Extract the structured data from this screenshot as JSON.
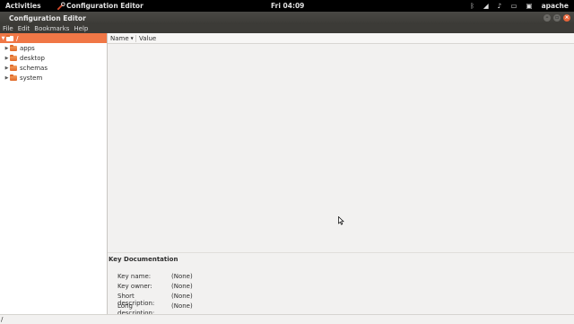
{
  "top_bar": {
    "activities": "Activities",
    "app_name": "Configuration Editor",
    "clock": "Fri 04:09",
    "user": "apache"
  },
  "window": {
    "title": "Configuration Editor",
    "controls": {
      "minimize": "–",
      "maximize": "▫",
      "close": "×"
    }
  },
  "menu": [
    "File",
    "Edit",
    "Bookmarks",
    "Help"
  ],
  "tree": {
    "root": "/",
    "children": [
      "apps",
      "desktop",
      "schemas",
      "system"
    ]
  },
  "list": {
    "columns": {
      "name": "Name",
      "value": "Value"
    }
  },
  "documentation": {
    "heading": "Key Documentation",
    "rows": [
      {
        "label": "Key name:",
        "value": "(None)"
      },
      {
        "label": "Key owner:",
        "value": "(None)"
      },
      {
        "label": "Short description:",
        "value": "(None)"
      },
      {
        "label": "Long description:",
        "value": "(None)"
      }
    ]
  },
  "status": "/",
  "colors": {
    "selection": "#f07746",
    "close_button": "#e8653a"
  }
}
